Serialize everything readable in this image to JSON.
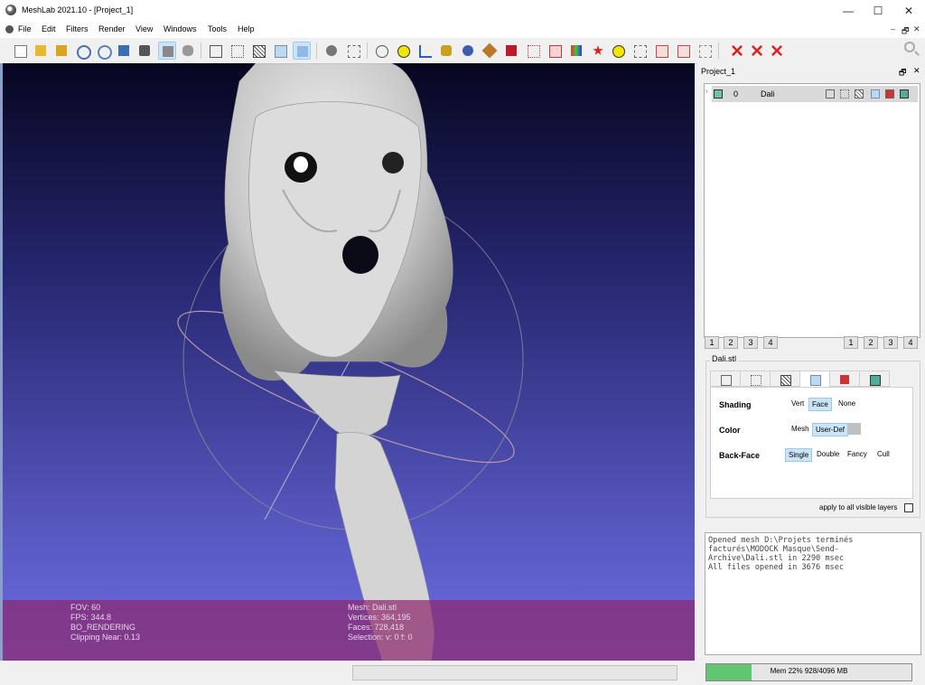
{
  "window": {
    "title": "MeshLab 2021.10 - [Project_1]"
  },
  "menu": [
    "File",
    "Edit",
    "Filters",
    "Render",
    "View",
    "Windows",
    "Tools",
    "Help"
  ],
  "mdi_controls": [
    "–",
    "🗗",
    "✕"
  ],
  "toolbar": {
    "buttons": [
      "new-file",
      "open-project",
      "open-file",
      "reload",
      "reload-all",
      "save-snapshot",
      "export",
      "camera",
      "render-mode-flat",
      "render-mode-smooth",
      "bbox",
      "points",
      "wireframe",
      "faces-flat",
      "faces-smooth",
      "layer-manager",
      "align",
      "trackball",
      "measure",
      "annotate",
      "pick-points",
      "paint",
      "raster",
      "select-vertices",
      "select-faces",
      "delete-selection",
      "color-selection",
      "info",
      "select-connected",
      "edit-plus",
      "edit-minus",
      "pick",
      "delete-faces",
      "delete-vertices",
      "delete-all"
    ]
  },
  "viewport": {
    "info_left": [
      "FOV: 60",
      "FPS:   344.8",
      "BO_RENDERING",
      "Clipping Near:    0.13"
    ],
    "info_right": [
      "Mesh: Dali.stl",
      "Vertices: 364,195",
      "Faces: 728,418",
      "Selection: v: 0 f: 0"
    ]
  },
  "layers_panel": {
    "title": "Project_1",
    "layer": {
      "index": "0",
      "name": "Dali"
    },
    "view_buttons_left": [
      "1",
      "2",
      "3",
      "4"
    ],
    "view_buttons_right": [
      "1",
      "2",
      "3",
      "4"
    ]
  },
  "render_group": {
    "title": "Dali.stl",
    "tabs": [
      "bbox",
      "points",
      "wireframe",
      "solid",
      "texture",
      "rgb"
    ],
    "rows": [
      {
        "label": "Shading",
        "options": [
          "Vert",
          "Face",
          "None"
        ],
        "selected": "Face"
      },
      {
        "label": "Color",
        "options": [
          "Mesh",
          "User-Def"
        ],
        "selected": "User-Def"
      },
      {
        "label": "Back-Face",
        "options": [
          "Single",
          "Double",
          "Fancy",
          "Cull"
        ],
        "selected": "Single"
      }
    ],
    "apply_all": "apply to all visible layers"
  },
  "log": [
    "Opened mesh D:\\Projets terminés",
    "facturés\\MODOCK Masque\\Send-",
    "Archive\\Dali.stl in 2290 msec",
    "All files opened in 3676 msec"
  ],
  "status": {
    "memory": "Mem 22% 928/4096 MB",
    "memory_fraction": 0.22
  }
}
